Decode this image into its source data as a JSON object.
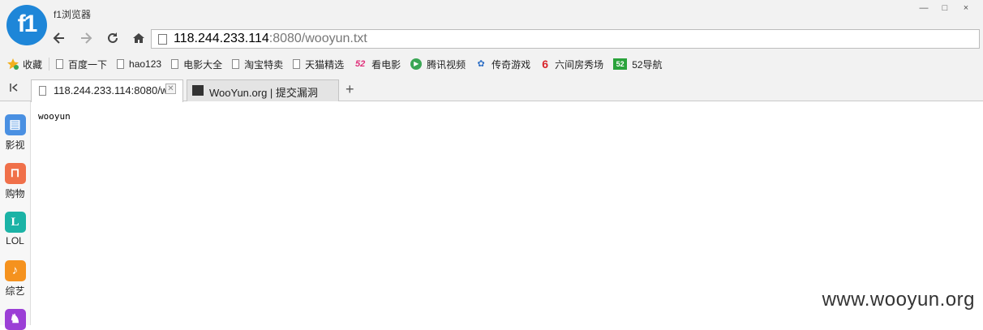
{
  "app": {
    "logo_text": "f1",
    "title": "f1浏览器"
  },
  "window_controls": [
    "—",
    "□",
    "×"
  ],
  "nav": {
    "back_icon": "arrow-left-icon",
    "forward_icon": "arrow-right-icon",
    "reload_icon": "reload-icon",
    "home_icon": "home-icon",
    "url_host": "118.244.233.114",
    "url_rest": ":8080/wooyun.txt"
  },
  "bookmarks": {
    "favorites_label": "收藏",
    "items": [
      {
        "label": "百度一下",
        "icon": "page-icon"
      },
      {
        "label": "hao123",
        "icon": "page-icon"
      },
      {
        "label": "电影大全",
        "icon": "page-icon"
      },
      {
        "label": "淘宝特卖",
        "icon": "page-icon"
      },
      {
        "label": "天猫精选",
        "icon": "page-icon"
      },
      {
        "label": "看电影",
        "icon": "52-logo-icon",
        "glyph": "52",
        "color": "#e0307a"
      },
      {
        "label": "腾讯视频",
        "icon": "tencent-video-icon",
        "glyph": "▶",
        "color": "#3aa654"
      },
      {
        "label": "传奇游戏",
        "icon": "game-icon",
        "glyph": "✿",
        "color": "#2f6fc5"
      },
      {
        "label": "六间房秀场",
        "icon": "six-room-icon",
        "glyph": "6",
        "color": "#d8232a"
      },
      {
        "label": "52导航",
        "icon": "52-nav-icon",
        "glyph": "52",
        "color": "#2aa33b"
      }
    ]
  },
  "tabs": [
    {
      "label": "118.244.233.114:8080/w",
      "active": true
    },
    {
      "label": "WooYun.org | 提交漏洞",
      "active": false
    }
  ],
  "new_tab_glyph": "+",
  "sidebar": [
    {
      "label": "影视",
      "icon": "film-icon",
      "glyph": "▤",
      "color": "#4a90e2"
    },
    {
      "label": "购物",
      "icon": "shopping-bag-icon",
      "glyph": "⊓",
      "color": "#f0704a"
    },
    {
      "label": "LOL",
      "icon": "lol-icon",
      "glyph": "L",
      "color": "#1bb3a6"
    },
    {
      "label": "综艺",
      "icon": "microphone-icon",
      "glyph": "♪",
      "color": "#f5921e"
    },
    {
      "label": "",
      "icon": "purple-app-icon",
      "glyph": "♞",
      "color": "#9b3fd6"
    }
  ],
  "page": {
    "body_text": "wooyun"
  },
  "watermark": "www.wooyun.org"
}
